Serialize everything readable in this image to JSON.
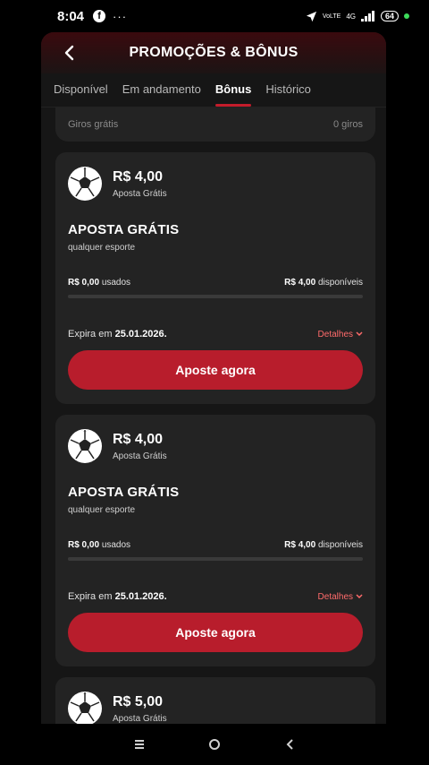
{
  "status_bar": {
    "time": "8:04",
    "dots": "···",
    "network_top": "VoLTE",
    "network_4g": "4G",
    "battery": "64"
  },
  "header": {
    "title": "PROMOÇÕES & BÔNUS"
  },
  "tabs": [
    {
      "label": "Disponível",
      "active": false
    },
    {
      "label": "Em andamento",
      "active": false
    },
    {
      "label": "Bônus",
      "active": true
    },
    {
      "label": "Histórico",
      "active": false
    }
  ],
  "previous_card": {
    "label": "Giros grátis",
    "value": "0 giros"
  },
  "bonuses": [
    {
      "amount": "R$ 4,00",
      "type": "Aposta Grátis",
      "title": "APOSTA GRÁTIS",
      "subtitle": "qualquer esporte",
      "used_value": "R$ 0,00",
      "used_label": "usados",
      "available_value": "R$ 4,00",
      "available_label": "disponíveis",
      "progress_fraction": 0,
      "expiry_label": "Expira em",
      "expiry_date": "25.01.2026.",
      "details_label": "Detalhes",
      "cta": "Aposte agora"
    },
    {
      "amount": "R$ 4,00",
      "type": "Aposta Grátis",
      "title": "APOSTA GRÁTIS",
      "subtitle": "qualquer esporte",
      "used_value": "R$ 0,00",
      "used_label": "usados",
      "available_value": "R$ 4,00",
      "available_label": "disponíveis",
      "progress_fraction": 0,
      "expiry_label": "Expira em",
      "expiry_date": "25.01.2026.",
      "details_label": "Detalhes",
      "cta": "Aposte agora"
    },
    {
      "amount": "R$ 5,00",
      "type": "Aposta Grátis"
    }
  ],
  "colors": {
    "accent": "#b81d2c",
    "card": "#232323",
    "background": "#161616",
    "details": "#ff6b6b"
  }
}
